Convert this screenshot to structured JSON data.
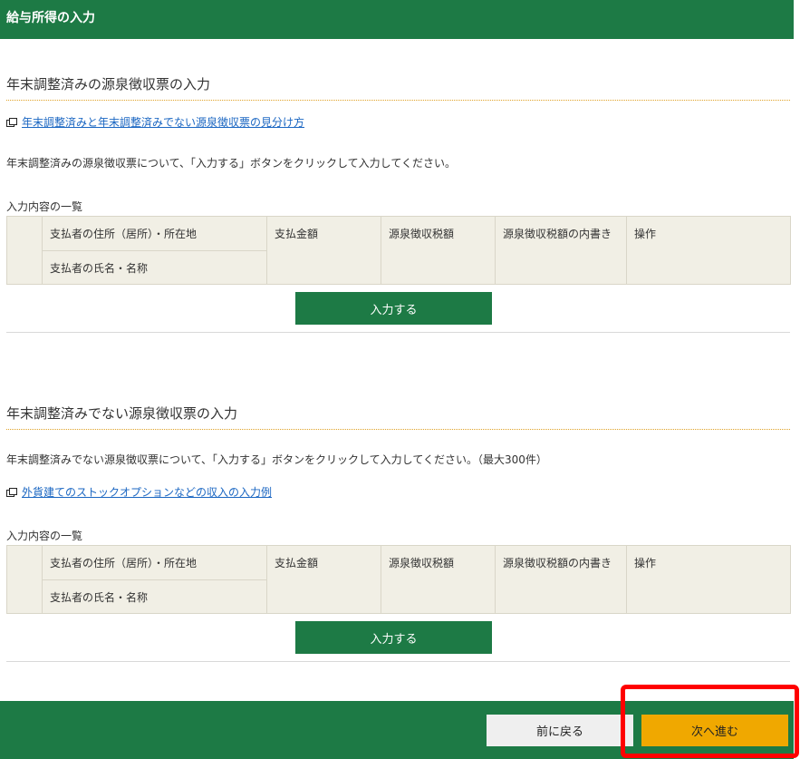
{
  "header": {
    "title": "給与所得の入力"
  },
  "section1": {
    "title": "年末調整済みの源泉徴収票の入力",
    "link": "年末調整済みと年末調整済みでない源泉徴収票の見分け方",
    "description": "年末調整済みの源泉徴収票について、「入力する」ボタンをクリックして入力してください。",
    "list_label": "入力内容の一覧",
    "columns": {
      "address": "支払者の住所（居所）・所在地",
      "name": "支払者の氏名・名称",
      "amount": "支払金額",
      "tax": "源泉徴収税額",
      "breakdown": "源泉徴収税額の内書き",
      "action": "操作"
    },
    "input_button": "入力する"
  },
  "section2": {
    "title": "年末調整済みでない源泉徴収票の入力",
    "description": "年末調整済みでない源泉徴収票について、「入力する」ボタンをクリックして入力してください。（最大300件）",
    "link": "外貨建てのストックオプションなどの収入の入力例",
    "list_label": "入力内容の一覧",
    "columns": {
      "address": "支払者の住所（居所）・所在地",
      "name": "支払者の氏名・名称",
      "amount": "支払金額",
      "tax": "源泉徴収税額",
      "breakdown": "源泉徴収税額の内書き",
      "action": "操作"
    },
    "input_button": "入力する"
  },
  "footer": {
    "back_button": "前に戻る",
    "next_button": "次へ進む"
  },
  "colors": {
    "brand_green": "#1d7a45",
    "next_orange": "#f0a800",
    "highlight_red": "#ff0000",
    "link_blue": "#1a66c2"
  }
}
